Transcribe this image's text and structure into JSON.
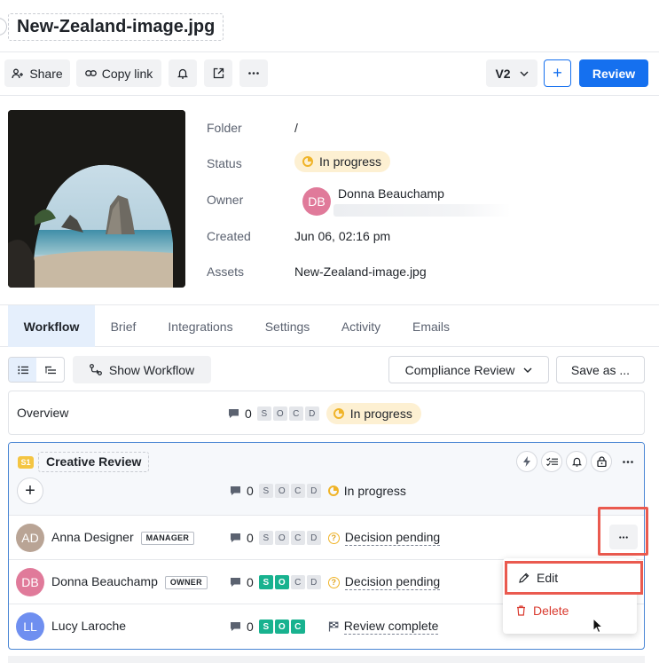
{
  "file": {
    "title": "New-Zealand-image.jpg"
  },
  "toolbar": {
    "share_label": "Share",
    "copy_link_label": "Copy link",
    "version_label": "V2",
    "add_label": "+",
    "review_label": "Review"
  },
  "details": {
    "folder_label": "Folder",
    "folder_value": "/",
    "status_label": "Status",
    "status_value": "In progress",
    "owner_label": "Owner",
    "owner_initials": "DB",
    "owner_name": "Donna Beauchamp",
    "created_label": "Created",
    "created_value": "Jun 06, 02:16 pm",
    "assets_label": "Assets",
    "assets_value": "New-Zealand-image.jpg"
  },
  "tabs": [
    {
      "label": "Workflow",
      "active": true
    },
    {
      "label": "Brief"
    },
    {
      "label": "Integrations"
    },
    {
      "label": "Settings"
    },
    {
      "label": "Activity"
    },
    {
      "label": "Emails"
    }
  ],
  "workflow_bar": {
    "show_workflow_label": "Show Workflow",
    "template_label": "Compliance Review",
    "save_as_label": "Save as ..."
  },
  "overview": {
    "label": "Overview",
    "comments": "0",
    "pills": [
      "S",
      "O",
      "C",
      "D"
    ],
    "status": "In progress"
  },
  "stage": {
    "badge": "S1",
    "title": "Creative Review",
    "comments": "0",
    "pills": [
      "S",
      "O",
      "C",
      "D"
    ],
    "status": "In progress"
  },
  "members": [
    {
      "initials": "AD",
      "name": "Anna Designer",
      "role": "MANAGER",
      "comments": "0",
      "pills": [
        "S",
        "O",
        "C",
        "D"
      ],
      "status": "Decision pending",
      "avatar_color": "#b9a495"
    },
    {
      "initials": "DB",
      "name": "Donna Beauchamp",
      "role": "OWNER",
      "comments": "0",
      "pills": [
        "S",
        "O",
        "C",
        "D"
      ],
      "status": "Decision pending",
      "avatar_color": "#e07a9a"
    },
    {
      "initials": "LL",
      "name": "Lucy Laroche",
      "comments": "0",
      "pills": [
        "S",
        "O",
        "C"
      ],
      "status": "Review complete",
      "avatar_color": "#6f8ff0"
    }
  ],
  "context_menu": {
    "edit_label": "Edit",
    "delete_label": "Delete"
  },
  "colors": {
    "accent": "#1570ef",
    "approved": "#18b28f",
    "pending": "#f0b429",
    "highlight": "#ea5a4f",
    "danger": "#d93a2f"
  }
}
